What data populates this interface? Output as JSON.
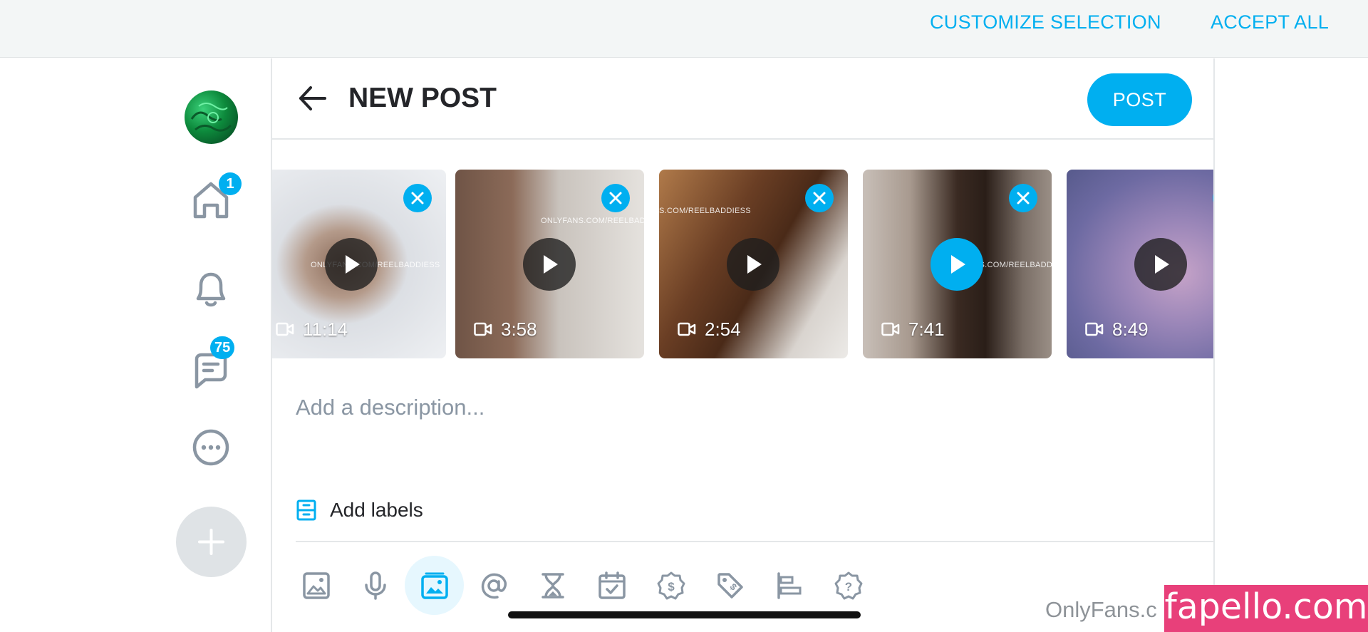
{
  "cookie_bar": {
    "customize_label": "CUSTOMIZE SELECTION",
    "accept_label": "ACCEPT ALL"
  },
  "nav": {
    "home_badge": "1",
    "messages_badge": "75",
    "icons": [
      "home-icon",
      "bell-icon",
      "messages-icon",
      "more-icon",
      "add-icon"
    ]
  },
  "header": {
    "title": "NEW POST",
    "post_label": "POST"
  },
  "media": [
    {
      "duration": "11:14",
      "watermark": "ONLYFANS.COM/REELBADDIESS",
      "playing": false
    },
    {
      "duration": "3:58",
      "watermark": "ONLYFANS.COM/REELBADDIESS",
      "playing": false
    },
    {
      "duration": "2:54",
      "watermark": "S.COM/REELBADDIESS",
      "playing": false
    },
    {
      "duration": "7:41",
      "watermark": "LYFANS.COM/REELBADDIESS",
      "playing": true
    },
    {
      "duration": "8:49",
      "watermark": "",
      "playing": false
    }
  ],
  "composer": {
    "description_placeholder": "Add a description...",
    "labels_label": "Add labels"
  },
  "toolbar": [
    "image-icon",
    "microphone-icon",
    "vault-icon",
    "mention-icon",
    "hourglass-icon",
    "calendar-icon",
    "price-icon",
    "tag-icon",
    "align-icon",
    "question-icon"
  ],
  "watermarks": {
    "onlyfans": "OnlyFans.c",
    "site": "fapello.com"
  },
  "colors": {
    "accent": "#00aff0",
    "text": "#242529",
    "muted": "#8a96a3",
    "icon": "#8a96a3"
  }
}
